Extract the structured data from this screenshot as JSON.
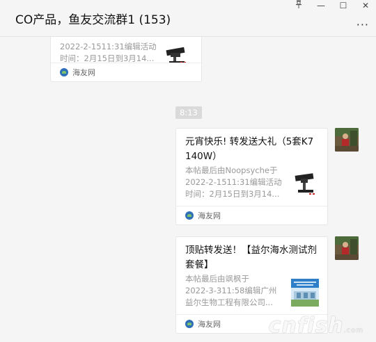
{
  "window": {
    "title": "CO产品，鱼友交流群1 (153)",
    "pin_icon": "pin-icon",
    "min_label": "—",
    "max_label": "☐",
    "close_label": "✕",
    "more_label": "···"
  },
  "chat": {
    "messages": [
      {
        "desc_lines": [
          "2022-2-1511:31编辑活动",
          "时间：2月15日到3月14..."
        ],
        "source": "海友网"
      },
      {
        "time": "8:13"
      },
      {
        "title": "元宵快乐! 转发送大礼（5套K7 140W）",
        "desc_lines": [
          "本帖最后由Noopsyche于",
          "2022-2-1511:31编辑活动",
          "时间：2月15日到3月14..."
        ],
        "source": "海友网"
      },
      {
        "title": "顶贴转发送！【益尔海水测试剂套餐】",
        "desc_lines": [
          "本帖最后由飒枫于",
          "2022-3-311:58编辑广州",
          "益尔生物工程有限公司..."
        ],
        "source": "海友网"
      }
    ]
  },
  "watermark": {
    "text": "cnfish",
    "suffix": ".com"
  }
}
